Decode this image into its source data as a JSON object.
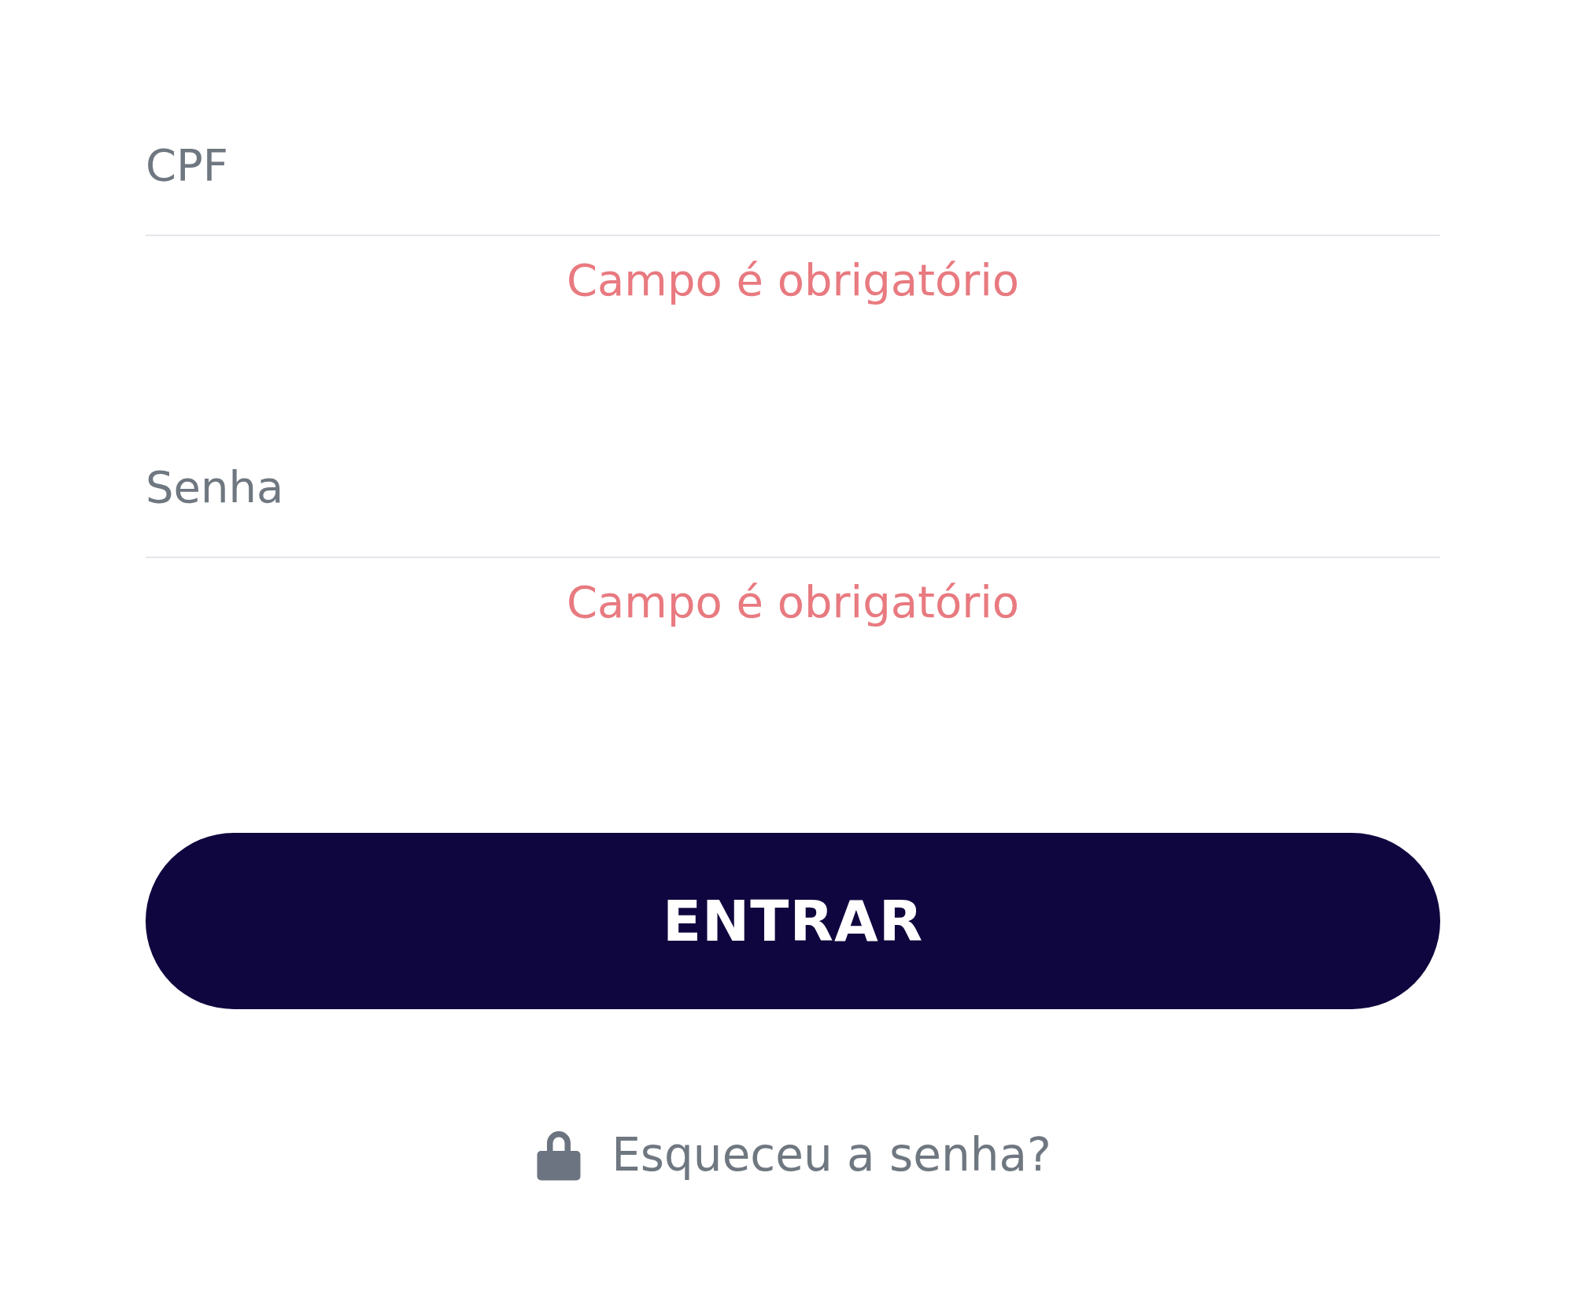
{
  "fields": [
    {
      "placeholder": "CPF",
      "error": "Campo é obrigatório"
    },
    {
      "placeholder": "Senha",
      "error": "Campo é obrigatório"
    }
  ],
  "button": {
    "label": "ENTRAR"
  },
  "forgot_link": {
    "label": "Esqueceu a senha?"
  }
}
